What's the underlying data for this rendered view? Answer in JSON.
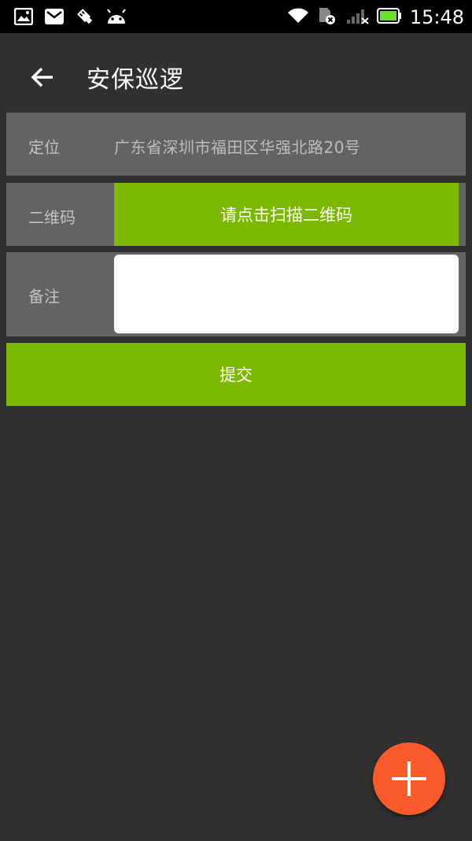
{
  "status_bar": {
    "time": "15:48",
    "left_icons": [
      "gallery-icon",
      "mail-icon",
      "usb-debug-icon",
      "android-icon"
    ],
    "right_icons": [
      "wifi-icon",
      "sim-card-icon",
      "cellular-signal-icon",
      "battery-icon"
    ]
  },
  "app_bar": {
    "title": "安保巡逻",
    "back_icon": "arrow-left-icon"
  },
  "form": {
    "location_label": "定位",
    "location_value": "广东省深圳市福田区华强北路20号",
    "qr_label": "二维码",
    "qr_button": "请点击扫描二维码",
    "remark_label": "备注",
    "remark_value": ""
  },
  "submit_label": "提交",
  "fab_icon": "plus-icon",
  "colors": {
    "background": "#303030",
    "row_background": "#636363",
    "accent_green": "#7cb800",
    "fab_orange": "#fb5a2a"
  }
}
